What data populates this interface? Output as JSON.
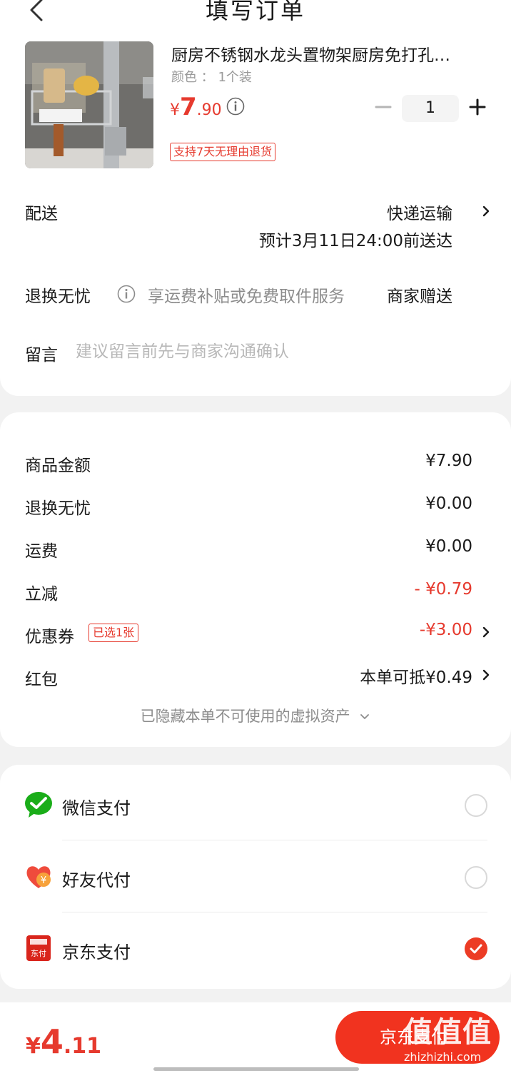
{
  "header": {
    "title": "填写订单"
  },
  "product": {
    "title": "厨房不锈钢水龙头置物架厨房免打孔…",
    "variant": "颜色 ： 1个装",
    "price_currency": "¥",
    "price_int": "7",
    "price_dec": ".90",
    "quantity": "1",
    "return_tag": "支持7天无理由退货"
  },
  "delivery": {
    "label": "配送",
    "method": "快递运输",
    "eta": "预计3月11日24:00前送达"
  },
  "worry_free": {
    "label": "退换无忧",
    "description": "享运费补贴或免费取件服务",
    "value": "商家赠送"
  },
  "message": {
    "label": "留言",
    "placeholder": "建议留言前先与商家沟通确认"
  },
  "summary": {
    "goods_label": "商品金额",
    "goods_value": "¥7.90",
    "worry_label": "退换无忧",
    "worry_value": "¥0.00",
    "shipping_label": "运费",
    "shipping_value": "¥0.00",
    "discount_label": "立减",
    "discount_value": "- ¥0.79",
    "coupon_label": "优惠券",
    "coupon_tag": "已选1张",
    "coupon_value": "-¥3.00",
    "redpacket_label": "红包",
    "redpacket_value": "本单可抵¥0.49",
    "hidden_assets": "已隐藏本单不可使用的虚拟资产"
  },
  "payment": {
    "options": [
      {
        "label": "微信支付",
        "icon": "wechat-pay-icon",
        "selected": false
      },
      {
        "label": "好友代付",
        "icon": "friend-pay-icon",
        "selected": false
      },
      {
        "label": "京东支付",
        "icon": "jd-pay-icon",
        "selected": true
      }
    ]
  },
  "bottom": {
    "total_currency": "¥",
    "total_int": "4",
    "total_dec": ".11",
    "pay_button": "京东支付"
  },
  "watermark": {
    "mark": "值值值",
    "url": "zhizhizhi.com"
  },
  "colors": {
    "accent_red": "#e63a2e",
    "pay_button": "#f1331f",
    "wechat_green": "#1aad19"
  }
}
